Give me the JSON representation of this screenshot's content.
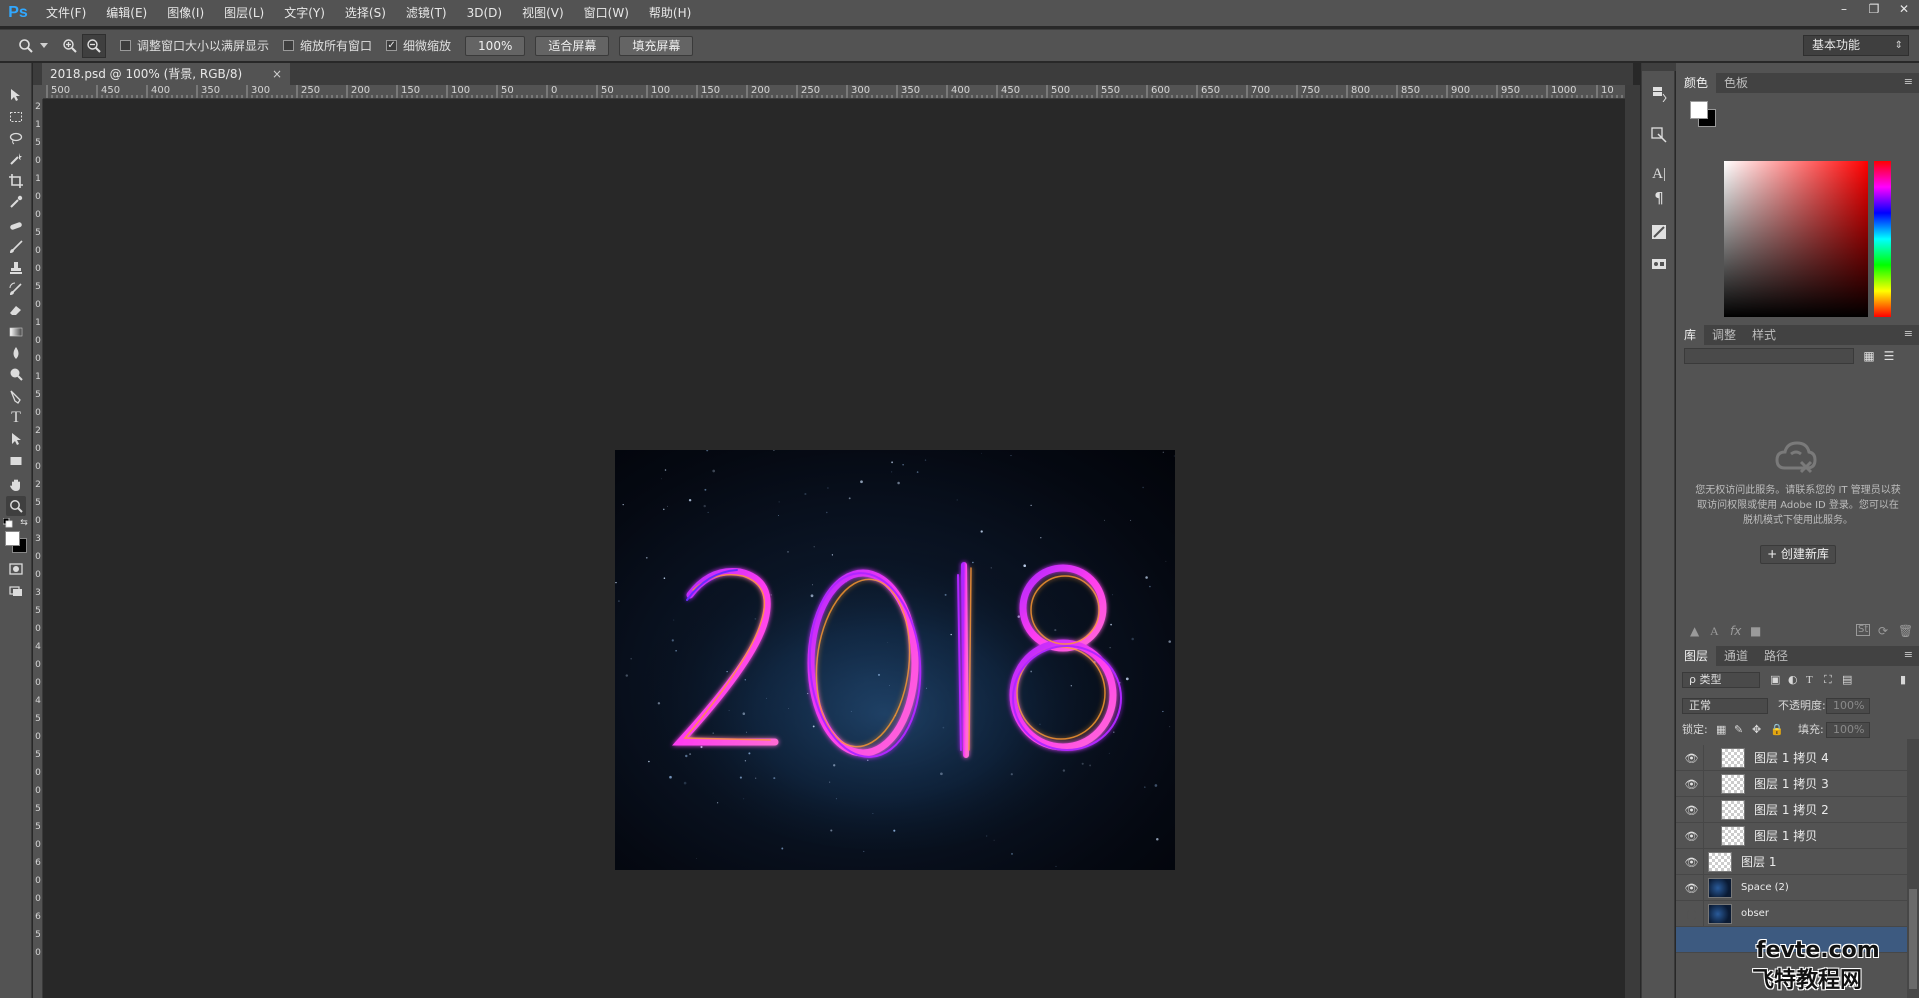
{
  "app": {
    "logo": "Ps"
  },
  "menu": [
    "文件(F)",
    "编辑(E)",
    "图像(I)",
    "图层(L)",
    "文字(Y)",
    "选择(S)",
    "滤镜(T)",
    "3D(D)",
    "视图(V)",
    "窗口(W)",
    "帮助(H)"
  ],
  "window_controls": {
    "minimize": "–",
    "restore": "❐",
    "close": "✕"
  },
  "options": {
    "fit_window_label": "调整窗口大小以满屏显示",
    "fit_window_checked": false,
    "zoom_all_label": "缩放所有窗口",
    "zoom_all_checked": false,
    "scrubby_label": "细微缩放",
    "scrubby_checked": true,
    "btn_100": "100%",
    "btn_fit": "适合屏幕",
    "btn_fill": "填充屏幕",
    "workspace": "基本功能"
  },
  "document": {
    "tab_title": "2018.psd @ 100% (背景, RGB/8)",
    "tab_close": "×",
    "artwork_text": "2018"
  },
  "ruler_top": [
    "500",
    "450",
    "400",
    "350",
    "300",
    "250",
    "200",
    "150",
    "100",
    "50",
    "0",
    "50",
    "100",
    "150",
    "200",
    "250",
    "300",
    "350",
    "400",
    "450",
    "500",
    "550",
    "600",
    "650",
    "700",
    "750",
    "800",
    "850",
    "900",
    "950",
    "1000",
    "10"
  ],
  "ruler_left": [
    "2",
    "1",
    "5",
    "0",
    "1",
    "0",
    "0",
    "5",
    "0",
    "0",
    "5",
    "0",
    "1",
    "0",
    "0",
    "1",
    "5",
    "0",
    "2",
    "0",
    "0",
    "2",
    "5",
    "0",
    "3",
    "0",
    "0",
    "3",
    "5",
    "0",
    "4",
    "0",
    "0",
    "4",
    "5",
    "0",
    "5",
    "0",
    "0",
    "5",
    "5",
    "0",
    "6",
    "0",
    "0",
    "6",
    "5",
    "0"
  ],
  "panels": {
    "color_tabs": [
      "颜色",
      "色板"
    ],
    "library_tabs": [
      "库",
      "调整",
      "样式"
    ],
    "library_message": "您无权访问此服务。请联系您的 IT 管理员以获取访问权限或使用 Adobe ID 登录。您可以在脱机模式下使用此服务。",
    "create_library": "+ 创建新库",
    "layer_tabs": [
      "图层",
      "通道",
      "路径"
    ],
    "filter_kind": "ρ 类型",
    "blend_mode": "正常",
    "opacity_label": "不透明度:",
    "opacity_value": "100%",
    "lock_label": "锁定:",
    "fill_label": "填充:",
    "fill_value": "100%"
  },
  "layers": [
    {
      "name": "图层 1 拷贝 4",
      "visible": true
    },
    {
      "name": "图层 1 拷贝 3",
      "visible": true
    },
    {
      "name": "图层 1 拷贝 2",
      "visible": true
    },
    {
      "name": "图层 1 拷贝",
      "visible": true
    },
    {
      "name": "图层 1",
      "visible": true
    },
    {
      "name": "Space (2)",
      "visible": true
    },
    {
      "name": "obser",
      "visible": false
    }
  ],
  "watermark": {
    "line1": "fevte.com",
    "line2": "飞特教程网"
  },
  "colors": {
    "menubar": "#535353",
    "canvas_bg": "#282828",
    "ps_blue": "#31a8ff",
    "neon_pink": "#ff3df0",
    "neon_purple": "#b026ff",
    "neon_orange": "#ff9a2e"
  }
}
